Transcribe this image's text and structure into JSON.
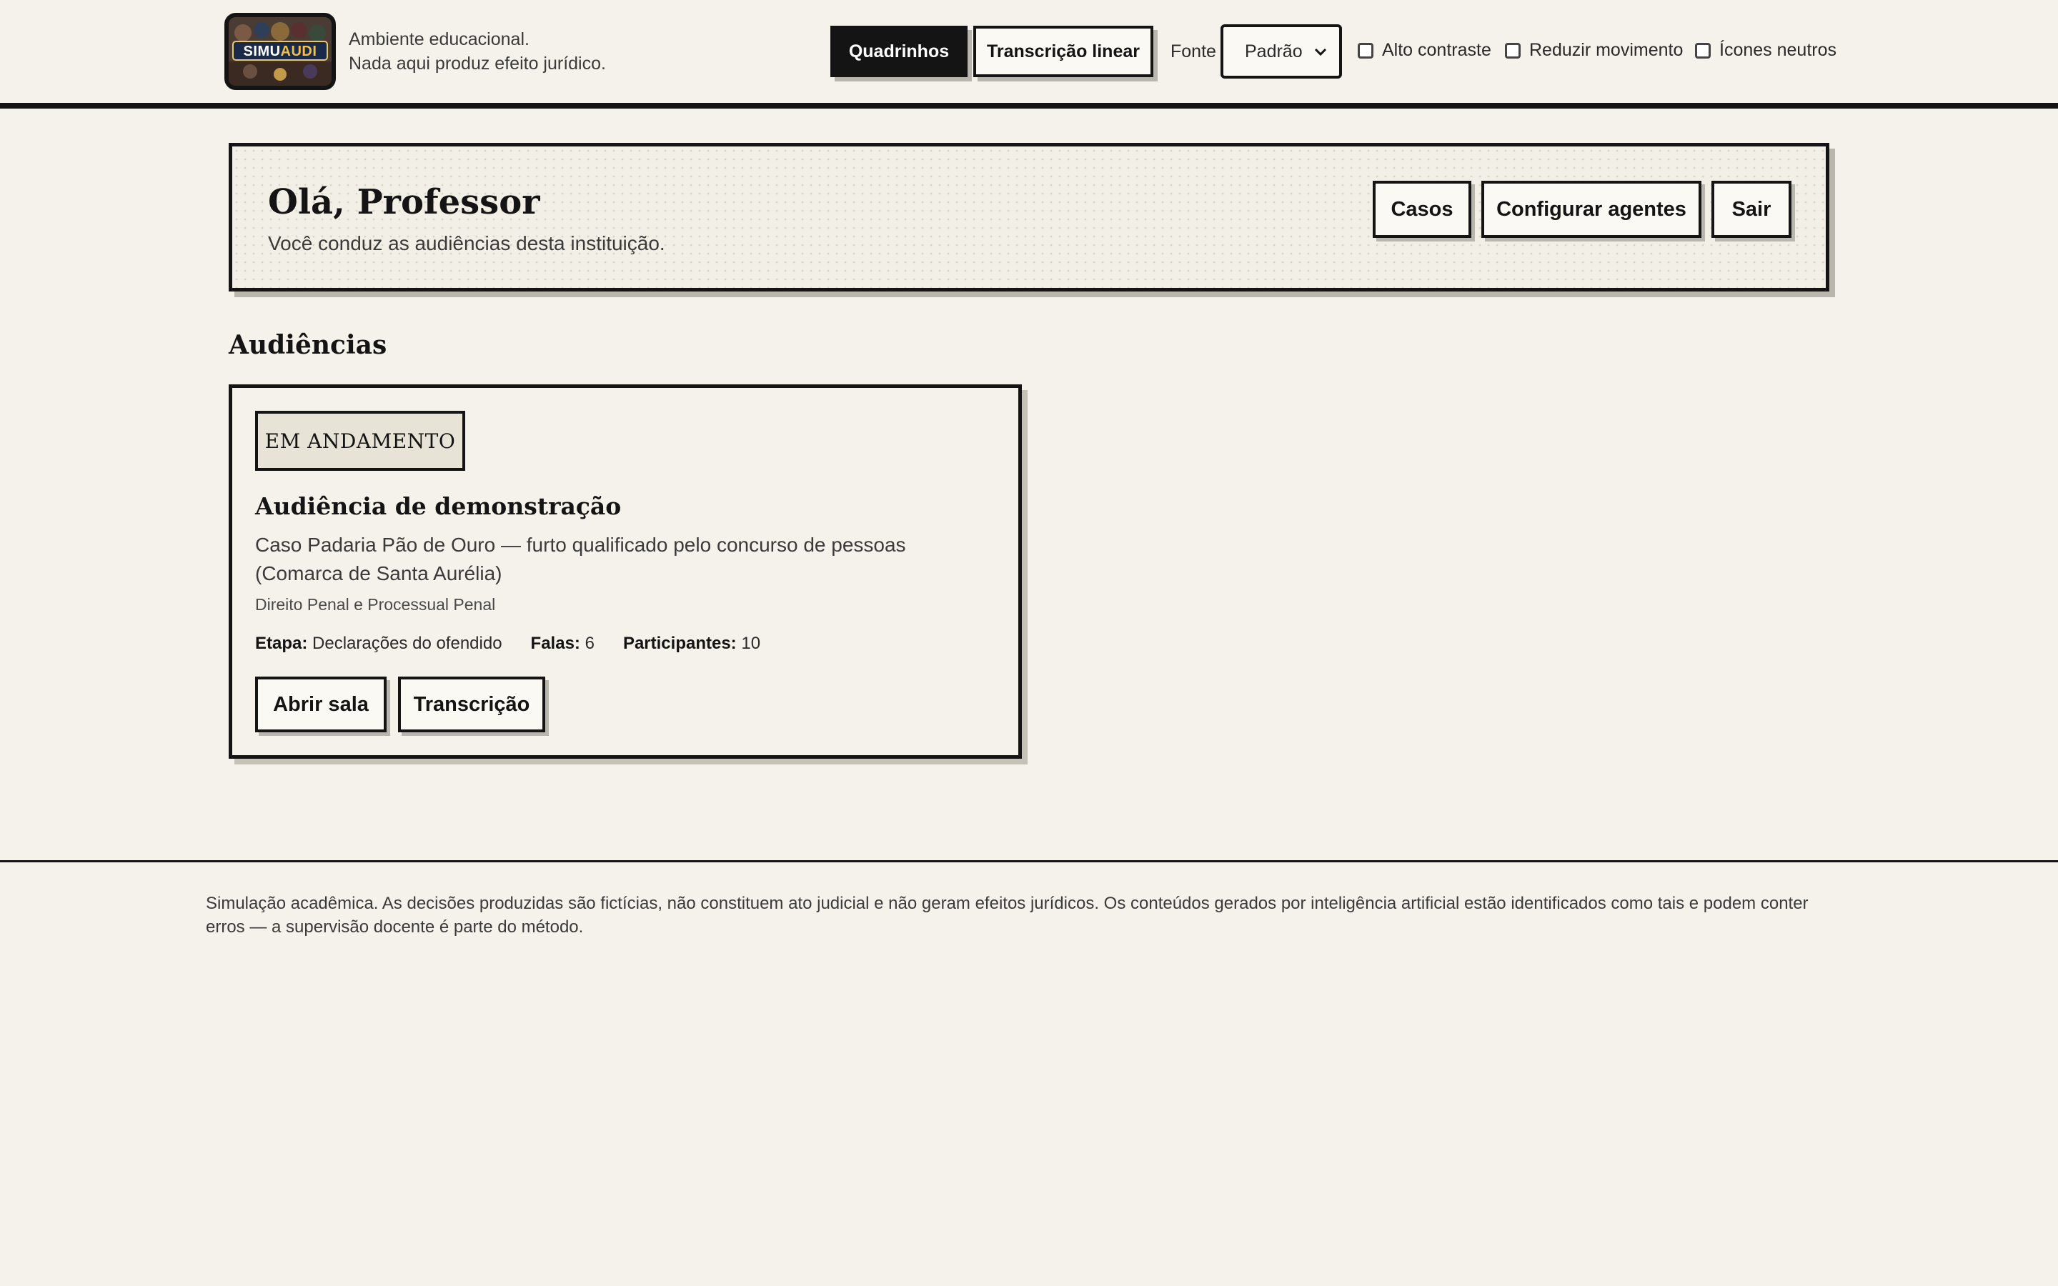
{
  "header": {
    "logo_text_1": "SIMU",
    "logo_text_2": "AUDI",
    "disclaimer_line1": "Ambiente educacional.",
    "disclaimer_line2": "Nada aqui produz efeito jurídico.",
    "mode_buttons": {
      "comics": "Quadrinhos",
      "linear": "Transcrição linear",
      "active": "comics"
    },
    "font_label": "Fonte",
    "font_select_value": "Padrão",
    "checkboxes": {
      "high_contrast": "Alto contraste",
      "reduce_motion": "Reduzir movimento",
      "neutral_icons": "Ícones neutros"
    }
  },
  "welcome": {
    "title": "Olá, Professor",
    "subtitle": "Você conduz as audiências desta instituição.",
    "buttons": {
      "cases": "Casos",
      "agents": "Configurar agentes",
      "logout": "Sair"
    }
  },
  "section": {
    "title": "Audiências"
  },
  "hearing": {
    "status": "EM ANDAMENTO",
    "title": "Audiência de demonstração",
    "description": "Caso Padaria Pão de Ouro — furto qualificado pelo concurso de pessoas (Comarca de Santa Aurélia)",
    "area": "Direito Penal e Processual Penal",
    "meta": {
      "stage_label": "Etapa:",
      "stage_value": "Declarações do ofendido",
      "lines_label": "Falas:",
      "lines_value": "6",
      "participants_label": "Participantes:",
      "participants_value": "10"
    },
    "buttons": {
      "open": "Abrir sala",
      "transcript": "Transcrição"
    }
  },
  "footer": {
    "text": "Simulação acadêmica. As decisões produzidas são fictícias, não constituem ato judicial e não geram efeitos jurídicos. Os conteúdos gerados por inteligência artificial estão identificados como tais e podem conter erros — a supervisão docente é parte do método."
  },
  "colors": {
    "background": "#f4f2ea",
    "ink": "#141414",
    "badge": "#e7e3d6",
    "shadow": "#b9b6ad"
  }
}
